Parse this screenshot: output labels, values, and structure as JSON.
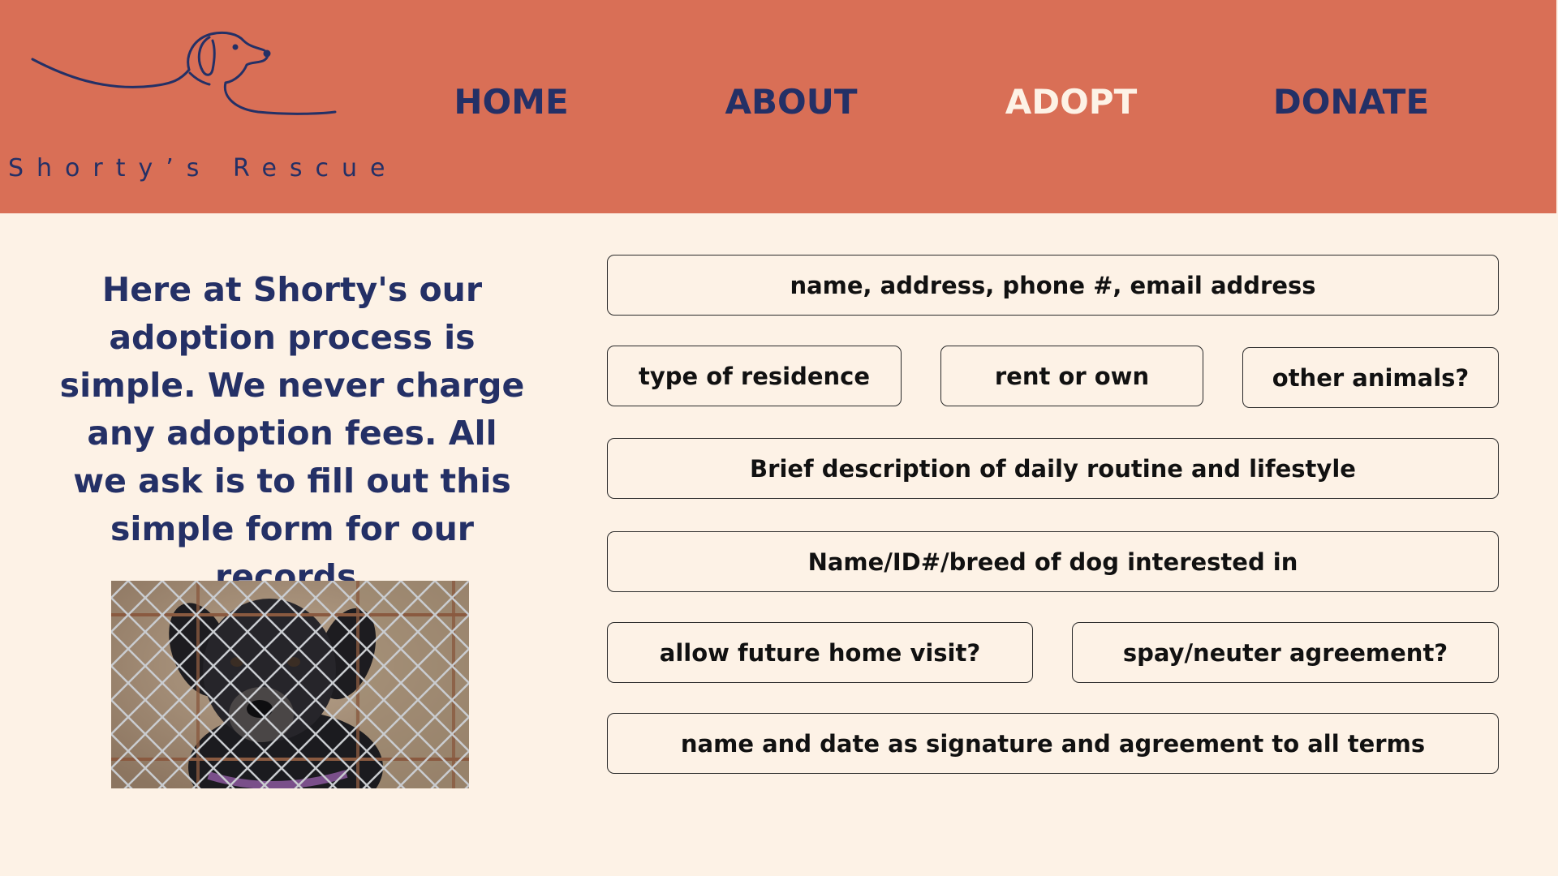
{
  "header": {
    "logo_text": "Shorty’s Rescue",
    "background_color": "#d96f56",
    "text_color": "#243066",
    "logo_icon": "dog-line-drawing"
  },
  "nav": {
    "items": [
      {
        "label": "HOME",
        "active": false
      },
      {
        "label": "ABOUT",
        "active": false
      },
      {
        "label": "ADOPT",
        "active": true
      },
      {
        "label": "DONATE",
        "active": false
      }
    ],
    "active_color": "#fdf2e6"
  },
  "main": {
    "intro_text": "Here at Shorty's our adoption process is simple. We never charge any adoption fees. All we ask is to fill out this simple form for our records.",
    "photo": "dog-behind-fence-photo",
    "background_color": "#fdf2e6"
  },
  "form": {
    "contact": "name, address, phone #, email address",
    "residence": "type of residence",
    "rent_own": "rent or own",
    "other_animals": "other animals?",
    "routine": "Brief description of daily routine and lifestyle",
    "dog_interest": "Name/ID#/breed of dog interested in",
    "home_visit": "allow future home visit?",
    "spay_neuter": "spay/neuter agreement?",
    "signature": "name and date as signature and agreement to all terms"
  }
}
